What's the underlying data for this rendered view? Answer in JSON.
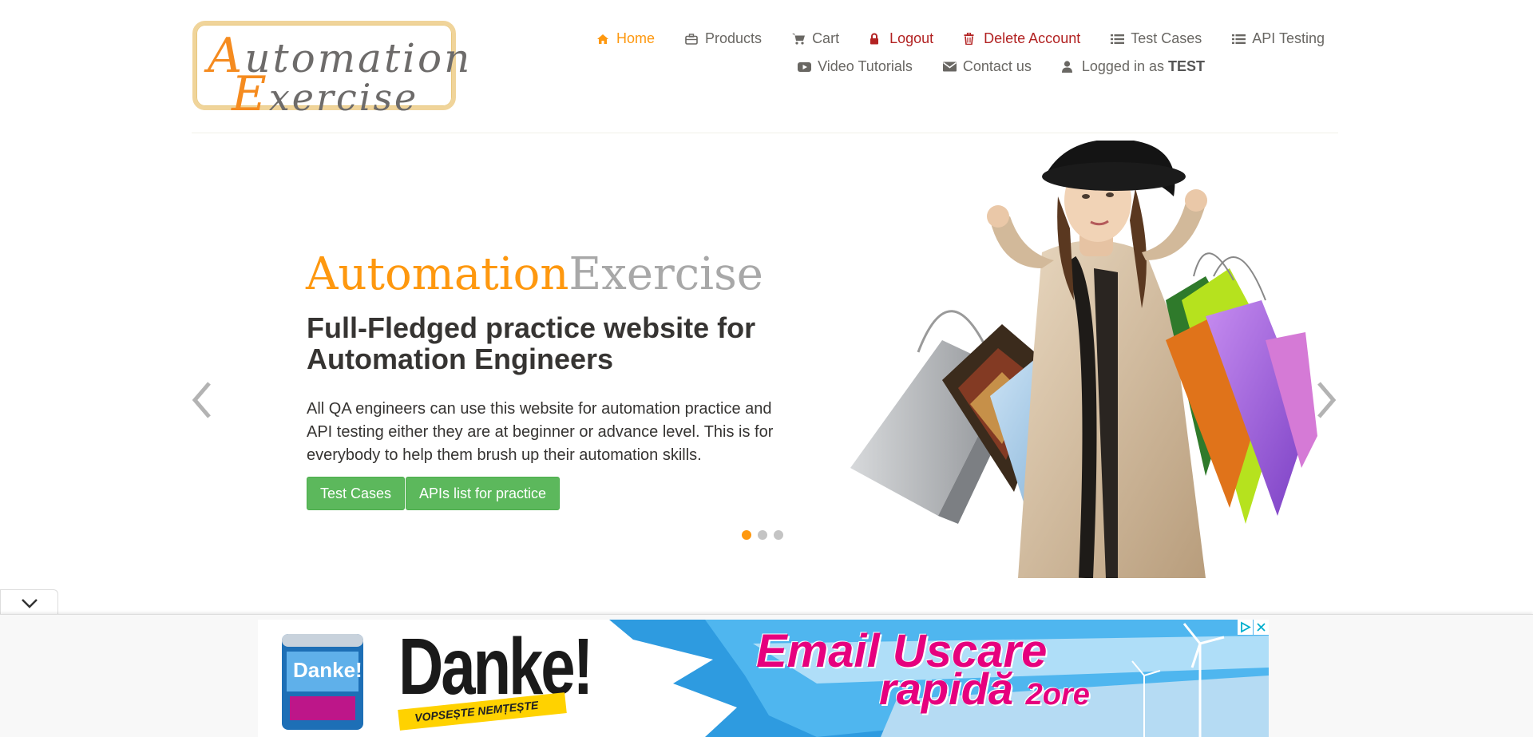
{
  "logo": {
    "line1": "Automation",
    "line2": "Exercise"
  },
  "nav": {
    "row1": [
      {
        "label": "Home",
        "icon": "home-icon",
        "state": "active"
      },
      {
        "label": "Products",
        "icon": "briefcase-icon",
        "state": "normal"
      },
      {
        "label": "Cart",
        "icon": "cart-icon",
        "state": "normal"
      },
      {
        "label": "Logout",
        "icon": "lock-icon",
        "state": "danger"
      },
      {
        "label": "Delete Account",
        "icon": "trash-icon",
        "state": "danger"
      },
      {
        "label": "Test Cases",
        "icon": "list-icon",
        "state": "normal"
      },
      {
        "label": "API Testing",
        "icon": "list-icon",
        "state": "normal"
      }
    ],
    "row2": [
      {
        "label": "Video Tutorials",
        "icon": "youtube-play-icon",
        "state": "normal"
      },
      {
        "label": "Contact us",
        "icon": "envelope-icon",
        "state": "normal"
      },
      {
        "label": "Logged in as",
        "username": "TEST",
        "icon": "user-icon",
        "state": "normal"
      }
    ]
  },
  "slider": {
    "brand_part1": "Automation",
    "brand_part2": "Exercise",
    "headline": "Full-Fledged practice website for Automation Engineers",
    "description": "All QA engineers can use this website for automation practice and API testing either they are at beginner or advance level. This is for everybody to help them brush up their automation skills.",
    "buttons": [
      "Test Cases",
      "APIs list for practice"
    ],
    "slide_count": 3,
    "active_slide": 1
  },
  "ad": {
    "brand": "Danke!",
    "can_label": "Danke!",
    "tagline": "VOPSEȘTE NEMȚEȘTE",
    "line1": "Email  Uscare",
    "line2_main": "rapidă",
    "line2_small": "2ore"
  },
  "colors": {
    "accent": "#fe980f",
    "danger": "#b22222",
    "button": "#5cb85c",
    "text": "#696763",
    "heading": "#363432",
    "ad_pink": "#e6007e"
  }
}
